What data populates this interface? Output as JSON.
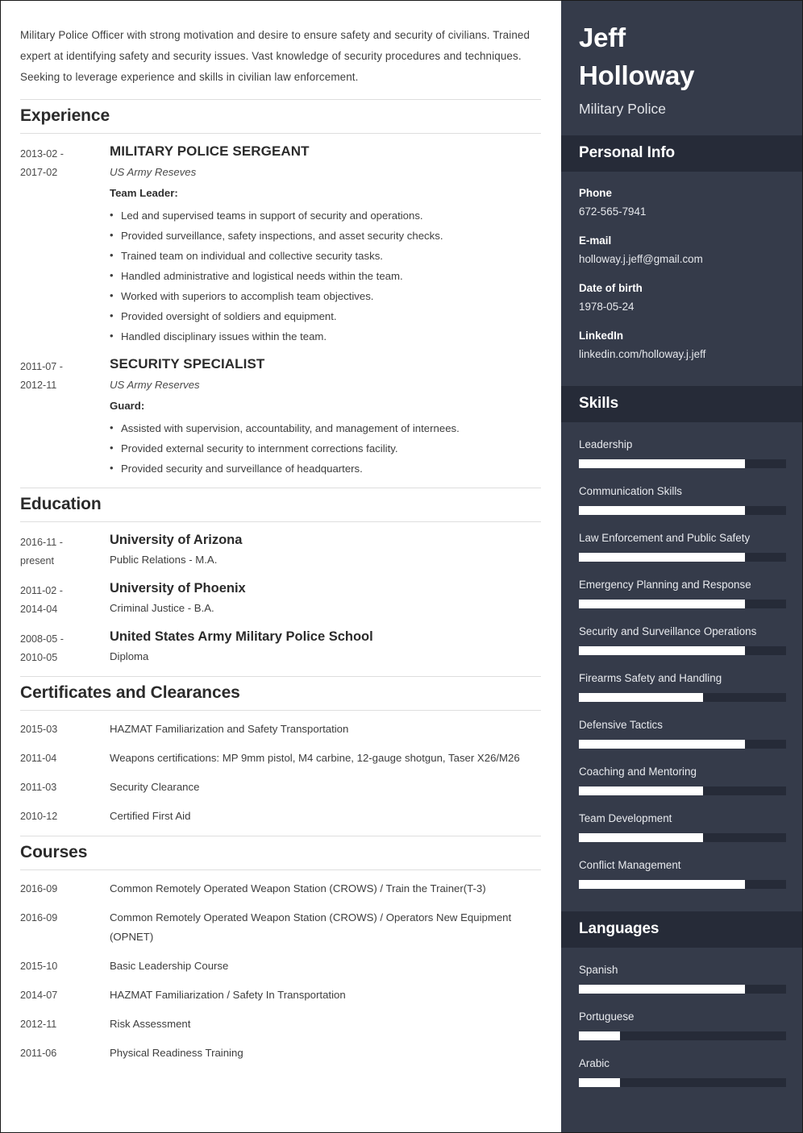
{
  "colors": {
    "sidebar_bg": "#353b4a",
    "sidebar_header_bg": "#262b38",
    "bar_fill": "#ffffff",
    "page_bg": "#ffffff"
  },
  "summary": "Military Police Officer with strong motivation and desire to ensure safety and security of civilians. Trained expert at identifying safety and security issues. Vast knowledge of security procedures and techniques. Seeking to leverage experience and skills in civilian law enforcement.",
  "sections": {
    "experience_title": "Experience",
    "education_title": "Education",
    "certificates_title": "Certificates and Clearances",
    "courses_title": "Courses"
  },
  "experience": [
    {
      "date_start": "2013-02 -",
      "date_end": "2017-02",
      "title": "MILITARY POLICE SERGEANT",
      "org": "US Army Reseves",
      "role": "Team Leader:",
      "bullets": [
        "Led and supervised teams in support of security and operations.",
        "Provided surveillance, safety inspections, and asset security checks.",
        "Trained team on individual and collective security tasks.",
        "Handled administrative and logistical needs within the team.",
        "Worked with superiors to accomplish team objectives.",
        "Provided oversight of soldiers and equipment.",
        "Handled disciplinary issues within the team."
      ]
    },
    {
      "date_start": "2011-07 -",
      "date_end": "2012-11",
      "title": "SECURITY SPECIALIST",
      "org": "US Army Reserves",
      "role": "Guard:",
      "bullets": [
        "Assisted with supervision, accountability, and management of internees.",
        "Provided external security to internment corrections facility.",
        "Provided security and surveillance of headquarters."
      ]
    }
  ],
  "education": [
    {
      "date_start": "2016-11 -",
      "date_end": "present",
      "school": "University of Arizona",
      "degree": "Public Relations - M.A."
    },
    {
      "date_start": "2011-02 -",
      "date_end": "2014-04",
      "school": "University of Phoenix",
      "degree": "Criminal Justice - B.A."
    },
    {
      "date_start": "2008-05 -",
      "date_end": "2010-05",
      "school": "United States Army Military Police School",
      "degree": "Diploma"
    }
  ],
  "certificates": [
    {
      "date": "2015-03",
      "text": "HAZMAT Familiarization and Safety Transportation"
    },
    {
      "date": "2011-04",
      "text": "Weapons certifications: MP 9mm pistol, M4 carbine, 12-gauge shotgun, Taser X26/M26"
    },
    {
      "date": "2011-03",
      "text": "Security Clearance"
    },
    {
      "date": "2010-12",
      "text": "Certified First Aid"
    }
  ],
  "courses": [
    {
      "date": "2016-09",
      "text": "Common Remotely Operated Weapon Station (CROWS) / Train the Trainer(T-3)"
    },
    {
      "date": "2016-09",
      "text": "Common Remotely Operated Weapon Station (CROWS) / Operators New Equipment (OPNET)"
    },
    {
      "date": "2015-10",
      "text": "Basic Leadership Course"
    },
    {
      "date": "2014-07",
      "text": "HAZMAT Familiarization / Safety In Transportation"
    },
    {
      "date": "2012-11",
      "text": "Risk Assessment"
    },
    {
      "date": "2011-06",
      "text": "Physical Readiness Training"
    }
  ],
  "sidebar": {
    "first_name": "Jeff",
    "last_name": "Holloway",
    "role": "Military Police",
    "personal_info_title": "Personal Info",
    "personal_info": [
      {
        "label": "Phone",
        "value": "672-565-7941"
      },
      {
        "label": "E-mail",
        "value": "holloway.j.jeff@gmail.com"
      },
      {
        "label": "Date of birth",
        "value": "1978-05-24"
      },
      {
        "label": "LinkedIn",
        "value": "linkedin.com/holloway.j.jeff"
      }
    ],
    "skills_title": "Skills",
    "skills": [
      {
        "name": "Leadership",
        "level": 80
      },
      {
        "name": "Communication Skills",
        "level": 80
      },
      {
        "name": "Law Enforcement and Public Safety",
        "level": 80
      },
      {
        "name": "Emergency Planning and Response",
        "level": 80
      },
      {
        "name": "Security and Surveillance Operations",
        "level": 80
      },
      {
        "name": "Firearms Safety and Handling",
        "level": 60
      },
      {
        "name": "Defensive Tactics",
        "level": 80
      },
      {
        "name": "Coaching and Mentoring",
        "level": 60
      },
      {
        "name": "Team Development",
        "level": 60
      },
      {
        "name": "Conflict Management",
        "level": 80
      }
    ],
    "languages_title": "Languages",
    "languages": [
      {
        "name": "Spanish",
        "level": 80
      },
      {
        "name": "Portuguese",
        "level": 20
      },
      {
        "name": "Arabic",
        "level": 20
      }
    ]
  }
}
